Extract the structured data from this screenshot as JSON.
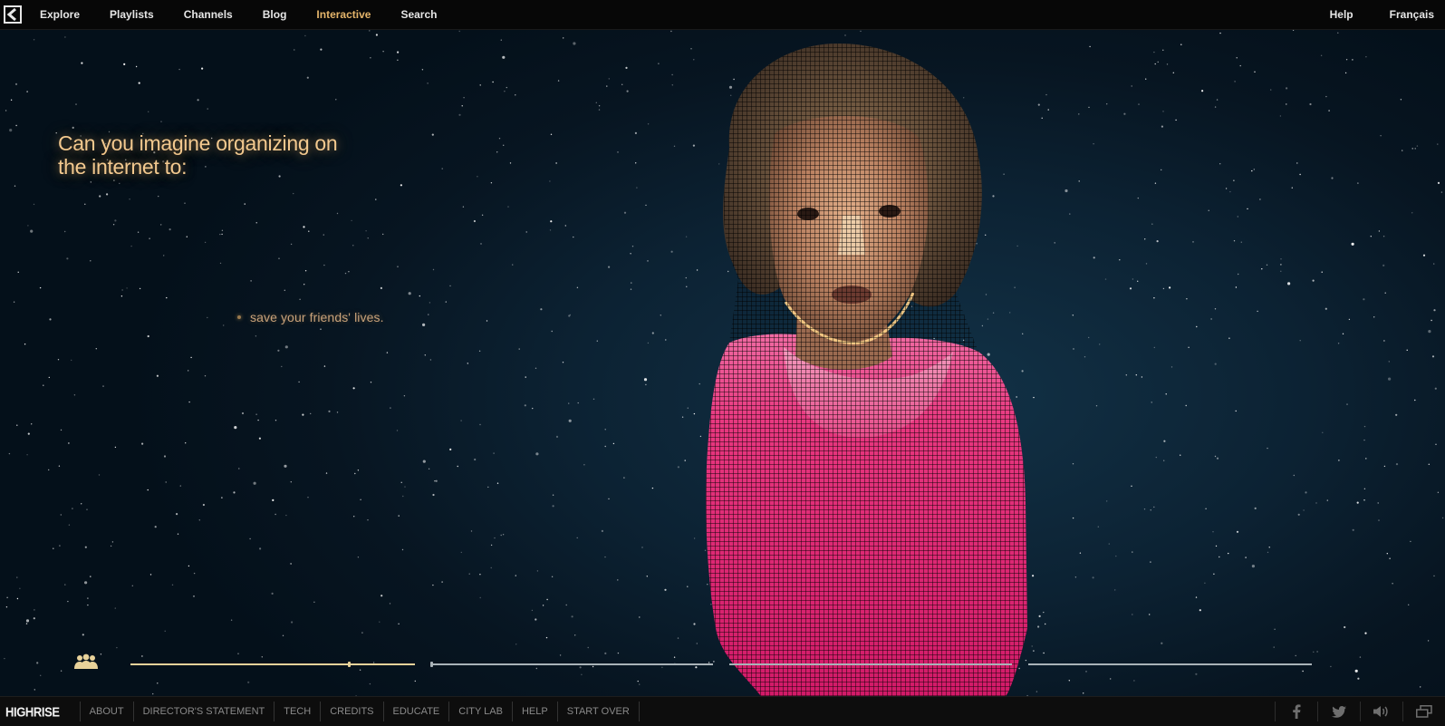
{
  "topnav": {
    "logo_icon": "highrise-logo-icon",
    "items": [
      {
        "label": "Explore",
        "active": false
      },
      {
        "label": "Playlists",
        "active": false
      },
      {
        "label": "Channels",
        "active": false
      },
      {
        "label": "Blog",
        "active": false
      },
      {
        "label": "Interactive",
        "active": true
      },
      {
        "label": "Search",
        "active": false
      }
    ],
    "right_items": [
      {
        "label": "Help"
      },
      {
        "label": "Français"
      }
    ]
  },
  "stage": {
    "question": "Can you imagine organizing on the internet to:",
    "option": "save your friends' lives."
  },
  "timeline": {
    "people_icon": "people-icon",
    "segments": 4,
    "active_segment": 1
  },
  "footer": {
    "brand": "HIGHRISE",
    "links": [
      "ABOUT",
      "DIRECTOR'S STATEMENT",
      "TECH",
      "CREDITS",
      "EDUCATE",
      "CITY LAB",
      "HELP",
      "START OVER"
    ],
    "icons": [
      "facebook-icon",
      "twitter-icon",
      "volume-icon",
      "window-icon"
    ]
  },
  "colors": {
    "accent": "#e4b46a",
    "question_text": "#f3c98f",
    "shirt_pink": "#e0307a",
    "background": "#0c2233"
  }
}
